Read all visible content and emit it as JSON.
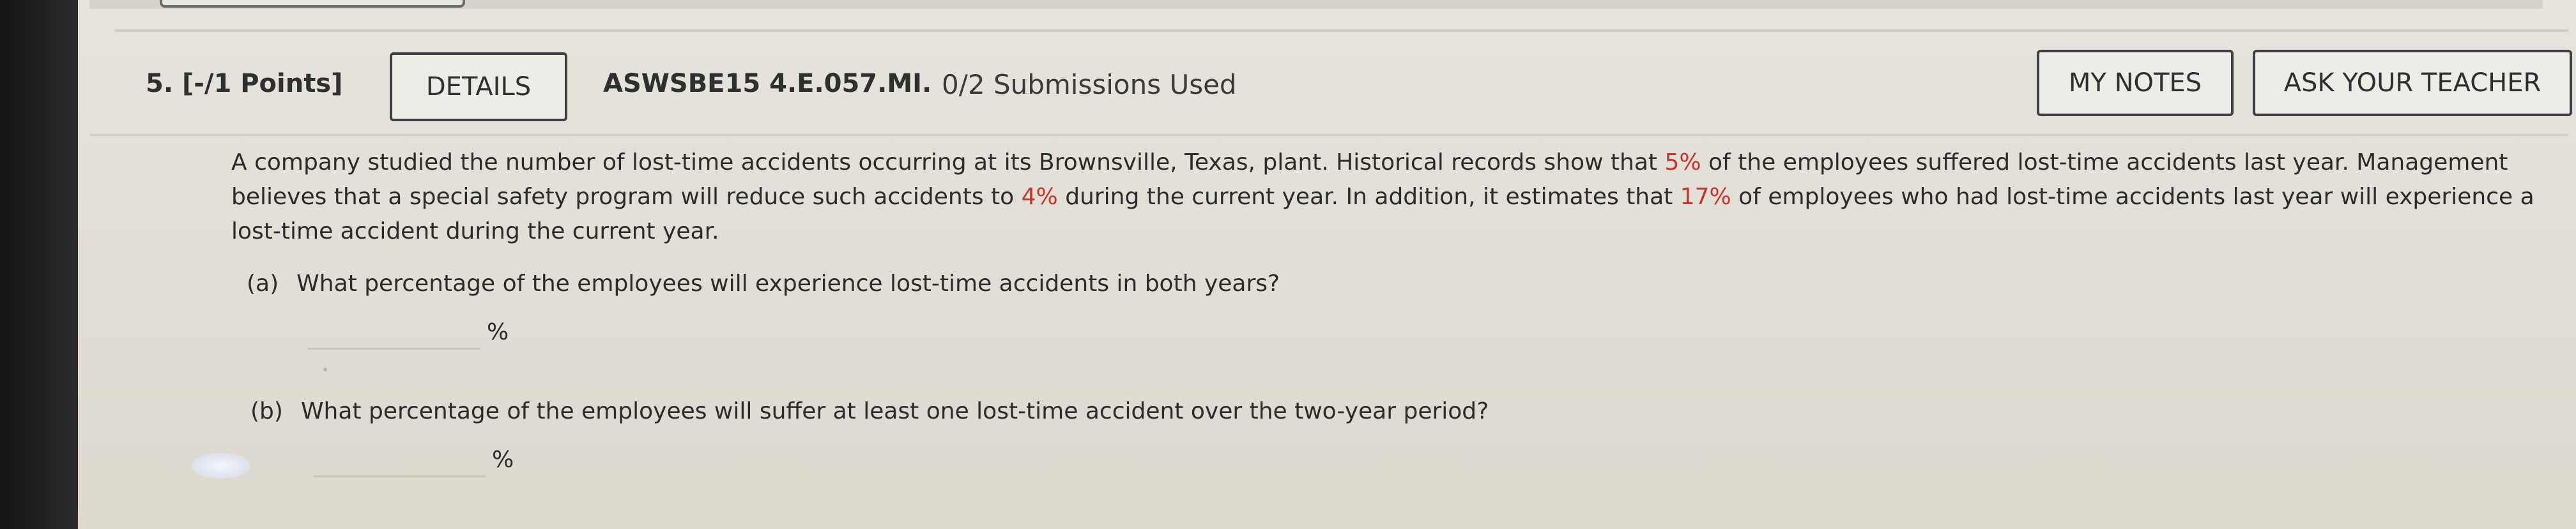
{
  "question": {
    "number_label": "5.  [-/1 Points]",
    "details_label": "DETAILS",
    "assignment_code": "ASWSBE15 4.E.057.MI.",
    "submissions": "0/2 Submissions Used",
    "my_notes_label": "MY NOTES",
    "ask_teacher_label": "ASK YOUR TEACHER"
  },
  "problem": {
    "text_1": "A company studied the number of lost-time accidents occurring at its Brownsville, Texas, plant. Historical records show that ",
    "value_1": "5%",
    "text_2": " of the employees suffered lost-time accidents last year. Management believes that a special safety program will reduce such accidents to ",
    "value_2": "4%",
    "text_3": " during the current year. In addition, it estimates that ",
    "value_3": "17%",
    "text_4": " of employees who had lost-time accidents last year will experience a lost-time accident during the current year."
  },
  "parts": [
    {
      "label": "(a)",
      "question": "What percentage of the employees will experience lost-time accidents in both years?",
      "answer_value": "",
      "unit": "%"
    },
    {
      "label": "(b)",
      "question": "What percentage of the employees will suffer at least one lost-time accident over the two-year period?",
      "answer_value": "",
      "unit": "%"
    }
  ],
  "colors": {
    "highlight_value": "#c8342a",
    "button_border": "#3f3f46"
  }
}
